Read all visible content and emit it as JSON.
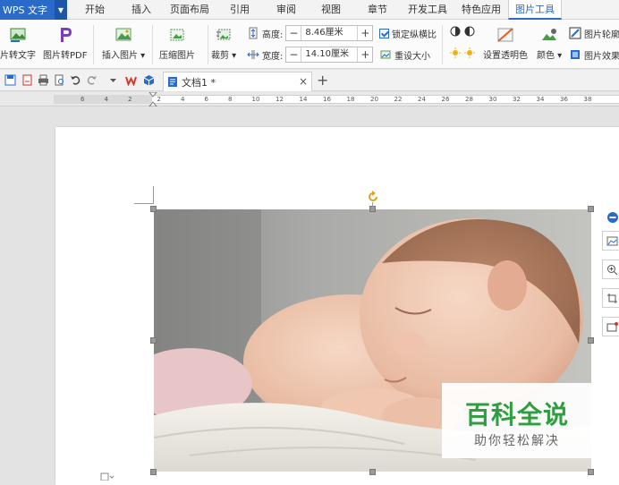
{
  "menubar": {
    "app_title": "WPS 文字",
    "tabs": [
      "开始",
      "插入",
      "页面布局",
      "引用",
      "审阅",
      "视图",
      "章节",
      "开发工具",
      "特色应用",
      "图片工具"
    ],
    "active_tab": "图片工具"
  },
  "ribbon": {
    "pic_to_text": "片转文字",
    "pic_to_pdf": "图片转PDF",
    "insert_picture": "插入图片",
    "compress_picture": "压缩图片",
    "crop": "裁剪",
    "height_label": "高度:",
    "height_value": "8.46厘米",
    "width_label": "宽度:",
    "width_value": "14.10厘米",
    "lock_ratio": "锁定纵横比",
    "reset_size": "重设大小",
    "set_transparent": "设置透明色",
    "color": "颜色",
    "pic_outline": "图片轮廓",
    "pic_effect": "图片效果",
    "minus": "−",
    "plus": "+"
  },
  "doc_tabs": {
    "tabs": [
      {
        "label": "文档1 *"
      }
    ],
    "close": "×",
    "new_tab": "+"
  },
  "ruler": {
    "numbers": [
      "6",
      "4",
      "2",
      "2",
      "4",
      "6",
      "8",
      "10",
      "12",
      "14",
      "16",
      "18",
      "20",
      "22",
      "24",
      "26",
      "28",
      "30",
      "32",
      "34",
      "36",
      "38"
    ]
  },
  "watermark": {
    "title": "百科全说",
    "subtitle": "助你轻松解决"
  },
  "colors": {
    "accent": "#2a6bc9",
    "watermark_green": "#2f9e3e"
  }
}
